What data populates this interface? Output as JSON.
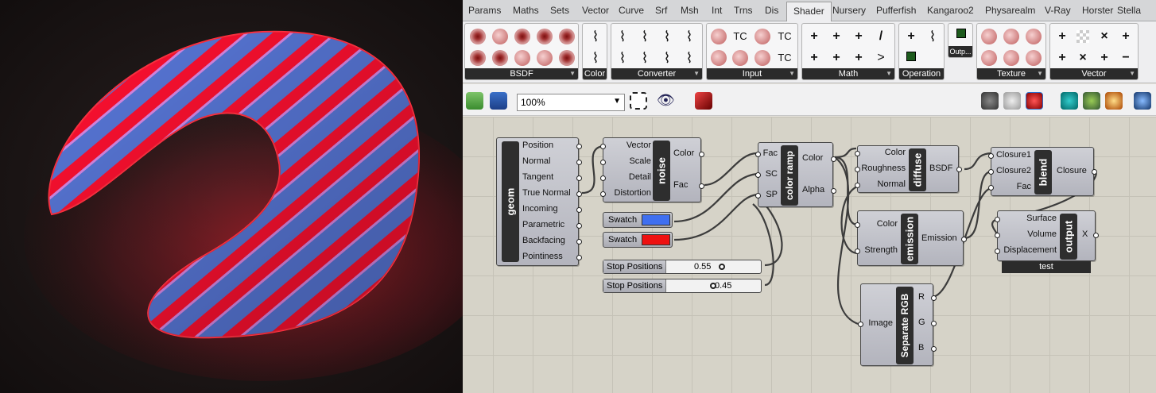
{
  "tabs": [
    "Params",
    "Maths",
    "Sets",
    "Vector",
    "Curve",
    "Srf",
    "Msh",
    "Int",
    "Trns",
    "Dis",
    "Shader",
    "Nursery",
    "Pufferfish",
    "Kangaroo2",
    "Physarealm",
    "V-Ray",
    "Horster",
    "Stella"
  ],
  "active_tab": "Shader",
  "ribbon_groups": {
    "bsdf": "BSDF",
    "color": "Color",
    "converter": "Converter",
    "input": "Input",
    "math": "Math",
    "operation": "Operation",
    "output": "Outp...",
    "texture": "Texture",
    "vector": "Vector"
  },
  "input_icons": {
    "tc": "TC"
  },
  "toolbar": {
    "zoom": "100%"
  },
  "nodes": {
    "geom": {
      "title": "geom",
      "outputs": [
        "Position",
        "Normal",
        "Tangent",
        "True Normal",
        "Incoming",
        "Parametric",
        "Backfacing",
        "Pointiness"
      ]
    },
    "noise": {
      "title": "noise",
      "inputs": [
        "Vector",
        "Scale",
        "Detail",
        "Distortion"
      ],
      "outputs": [
        "Color",
        "Fac"
      ]
    },
    "color_ramp": {
      "title": "color ramp",
      "inputs": [
        "Fac",
        "SC",
        "SP"
      ],
      "outputs": [
        "Color",
        "Alpha"
      ]
    },
    "diffuse": {
      "title": "diffuse",
      "inputs": [
        "Color",
        "Roughness",
        "Normal"
      ],
      "outputs": [
        "BSDF"
      ]
    },
    "blend": {
      "title": "blend",
      "inputs": [
        "Closure1",
        "Closure2",
        "Fac"
      ],
      "outputs": [
        "Closure"
      ]
    },
    "emission": {
      "title": "emission",
      "inputs": [
        "Color",
        "Strength"
      ],
      "outputs": [
        "Emission"
      ]
    },
    "output": {
      "title": "output",
      "inputs": [
        "Surface",
        "Volume",
        "Displacement"
      ],
      "outputs": [
        "X"
      ],
      "label": "test"
    },
    "separate_rgb": {
      "title": "Separate RGB",
      "inputs": [
        "Image"
      ],
      "outputs": [
        "R",
        "G",
        "B"
      ]
    }
  },
  "swatches": [
    {
      "label": "Swatch",
      "color": "#3f6ff0"
    },
    {
      "label": "Swatch",
      "color": "#ee1111"
    }
  ],
  "sliders": [
    {
      "label": "Stop Positions",
      "value": "0.55",
      "level": 0.55
    },
    {
      "label": "Stop Positions",
      "value": "0.45",
      "level": 0.45
    }
  ]
}
